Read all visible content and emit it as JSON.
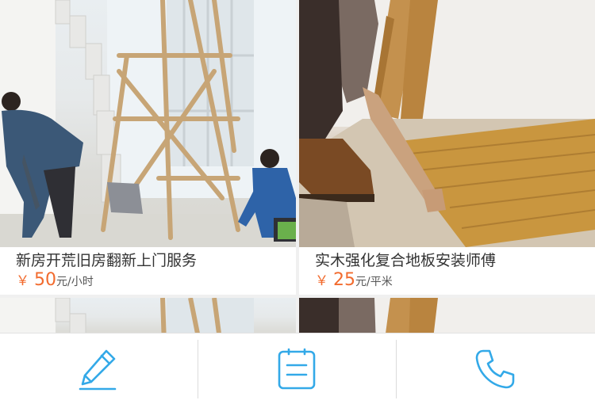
{
  "colors": {
    "accent": "#33a9e8",
    "price": "#f26b2e"
  },
  "listings": [
    {
      "title": "新房开荒旧房翻新上门服务",
      "currency": "￥",
      "price": "50",
      "unit": "元/小时",
      "image": "renovation-workers-photo"
    },
    {
      "title": "实木强化复合地板安装师傅",
      "currency": "￥",
      "price": "25",
      "unit": "元/平米",
      "image": "floor-installation-photo"
    },
    {
      "image": "renovation-workers-photo"
    },
    {
      "image": "floor-installation-photo"
    }
  ],
  "tabbar": {
    "items": [
      {
        "icon": "pencil-icon"
      },
      {
        "icon": "clipboard-icon"
      },
      {
        "icon": "phone-icon"
      }
    ]
  }
}
